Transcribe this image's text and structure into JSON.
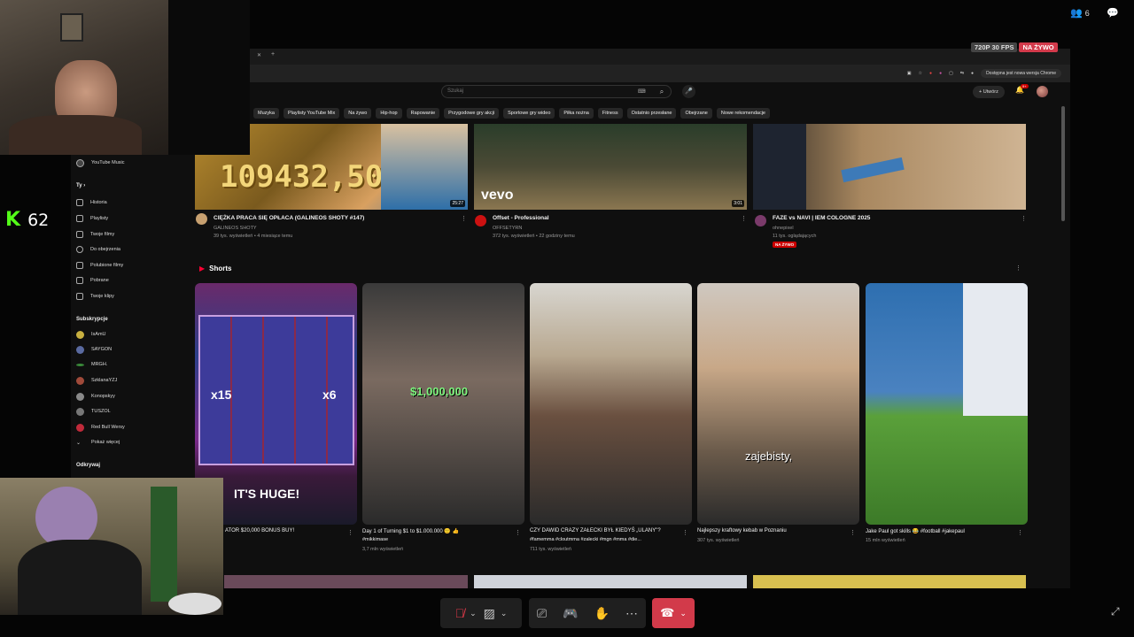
{
  "stream": {
    "viewer_count": "6",
    "quality_label": "720P 30 FPS",
    "live_label": "NA ŻYWO",
    "kick_viewers": "62"
  },
  "browser": {
    "update_notice": "Dostępna jest nowa wersja Chrome"
  },
  "youtube": {
    "search_placeholder": "Szukaj",
    "create_label": "Utwórz",
    "notification_count": "9+",
    "chips": [
      "Muzyka",
      "Playlisty YouTube Mix",
      "Na żywo",
      "Hip-hop",
      "Rapowanie",
      "Przygodowe gry akcji",
      "Sportowe gry wideo",
      "Piłka nożna",
      "Fitness",
      "Ostatnio przesłane",
      "Obejrzane",
      "Nowe rekomendacje"
    ],
    "sidebar": {
      "music": "YouTube Music",
      "you_header": "Ty",
      "you_items": [
        "Historia",
        "Playlisty",
        "Twoje filmy",
        "Do obejrzenia",
        "Polubione filmy",
        "Pobrane",
        "Twoje klipy"
      ],
      "subs_header": "Subskrypcje",
      "subs": [
        "IsAmU",
        "SAYGON",
        "MRGH.",
        "SzklanaYZJ",
        "Konopskyy",
        "TUSZOL",
        "Red Bull Wersy"
      ],
      "show_more": "Pokaż więcej",
      "explore_header": "Odkrywaj"
    },
    "videos": [
      {
        "title": "CIĘŻKA PRACA SIĘ OPŁACA (GALINEOS SHOTY #147)",
        "channel": "GALINEOS SHOTY",
        "meta": "39 tys. wyświetleń • 4 miesiące temu",
        "duration": "25:27",
        "thumb_text": "109432,50"
      },
      {
        "title": "Offset - Professional",
        "channel": "OFFSETYRN",
        "meta": "372 tys. wyświetleń • 22 godziny temu",
        "duration": "3:01",
        "thumb_text": "vevo"
      },
      {
        "title": "FAZE vs NAVI | IEM COLOGNE 2025",
        "channel": "ohnepixel",
        "meta": "11 tys. oglądających",
        "live": "NA ŻYWO"
      }
    ],
    "shorts_header": "Shorts",
    "shorts": [
      {
        "title": "ATOR $20,000 BONUS BUY!",
        "meta": "",
        "overlay": "IT'S HUGE!"
      },
      {
        "title": "Day 1 of Turning $1 to $1.000.000 🙂 👍",
        "title2": "#mikkimase",
        "meta": "3,7 mln wyświetleń",
        "overlay": "$1,000,000"
      },
      {
        "title": "CZY DAWID CRAZY ZAŁECKI BYŁ KIEDYŚ „ULANY\"?",
        "title2": "#famemma #cloutmma #zalecki #mgn #mma #die...",
        "meta": "711 tys. wyświetleń",
        "overlay": ""
      },
      {
        "title": "Najlepszy kraftowy kebab w Poznaniu",
        "meta": "307 tys. wyświetleń",
        "overlay": "zajebisty,"
      },
      {
        "title": "Jake Paul got skills 😂 #football #jakepaul",
        "meta": "15 mln wyświetleń",
        "overlay": ""
      }
    ]
  }
}
